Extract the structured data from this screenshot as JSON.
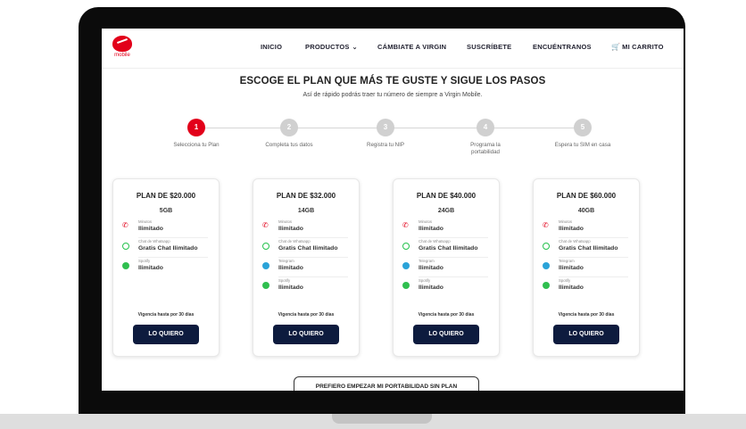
{
  "nav": {
    "logo_text": "mobile",
    "items": [
      "INICIO",
      "PRODUCTOS",
      "CÁMBIATE A VIRGIN",
      "SUSCRÍBETE",
      "ENCUÉNTRANOS",
      "MI CARRITO"
    ],
    "productos_chevron": "⌄",
    "cart_icon": "cart-icon"
  },
  "hero": {
    "title": "ESCOGE EL PLAN QUE MÁS TE GUSTE Y SIGUE LOS PASOS",
    "subtitle": "Así de rápido podrás traer tu número de siempre a Virgin Mobile."
  },
  "steps": [
    {
      "num": "1",
      "label": "Selecciona tu Plan",
      "active": true
    },
    {
      "num": "2",
      "label": "Completa tus datos",
      "active": false
    },
    {
      "num": "3",
      "label": "Registra tu NIP",
      "active": false
    },
    {
      "num": "4",
      "label": "Programa la portabilidad",
      "active": false
    },
    {
      "num": "5",
      "label": "Espera tu SIM en casa",
      "active": false
    }
  ],
  "plans": [
    {
      "title": "PLAN DE $20.000",
      "data": "5GB",
      "features": [
        {
          "icon": "phone-icon",
          "label": "Minutos",
          "value": "Ilimitado"
        },
        {
          "icon": "whatsapp-icon",
          "label": "Chat de Whatsapp",
          "value": "Gratis Chat Ilimitado"
        },
        {
          "icon": "spotify-icon",
          "label": "Spotify",
          "value": "Ilimitado"
        }
      ],
      "validity": "Vigencia hasta por 30 días",
      "button": "LO QUIERO"
    },
    {
      "title": "PLAN DE $32.000",
      "data": "14GB",
      "features": [
        {
          "icon": "phone-icon",
          "label": "Minutos",
          "value": "Ilimitado"
        },
        {
          "icon": "whatsapp-icon",
          "label": "Chat de Whatsapp",
          "value": "Gratis Chat Ilimitado"
        },
        {
          "icon": "telegram-icon",
          "label": "Telegram",
          "value": "Ilimitado"
        },
        {
          "icon": "spotify-icon",
          "label": "Spotify",
          "value": "Ilimitado"
        }
      ],
      "validity": "Vigencia hasta por 30 días",
      "button": "LO QUIERO"
    },
    {
      "title": "PLAN DE $40.000",
      "data": "24GB",
      "features": [
        {
          "icon": "phone-icon",
          "label": "Minutos",
          "value": "Ilimitado"
        },
        {
          "icon": "whatsapp-icon",
          "label": "Chat de Whatsapp",
          "value": "Gratis Chat Ilimitado"
        },
        {
          "icon": "telegram-icon",
          "label": "Telegram",
          "value": "Ilimitado"
        },
        {
          "icon": "spotify-icon",
          "label": "Spotify",
          "value": "Ilimitado"
        }
      ],
      "validity": "Vigencia hasta por 30 días",
      "button": "LO QUIERO"
    },
    {
      "title": "PLAN DE $60.000",
      "data": "40GB",
      "features": [
        {
          "icon": "phone-icon",
          "label": "Minutos",
          "value": "Ilimitado"
        },
        {
          "icon": "whatsapp-icon",
          "label": "Chat de Whatsapp",
          "value": "Gratis Chat Ilimitado"
        },
        {
          "icon": "telegram-icon",
          "label": "Telegram",
          "value": "Ilimitado"
        },
        {
          "icon": "spotify-icon",
          "label": "Spotify",
          "value": "Ilimitado"
        }
      ],
      "validity": "Vigencia hasta por 30 días",
      "button": "LO QUIERO"
    }
  ],
  "bottom_button": "PREFIERO EMPEZAR MI PORTABILIDAD SIN PLAN",
  "colors": {
    "brand_red": "#e2001a",
    "button_navy": "#0d1b3e"
  }
}
